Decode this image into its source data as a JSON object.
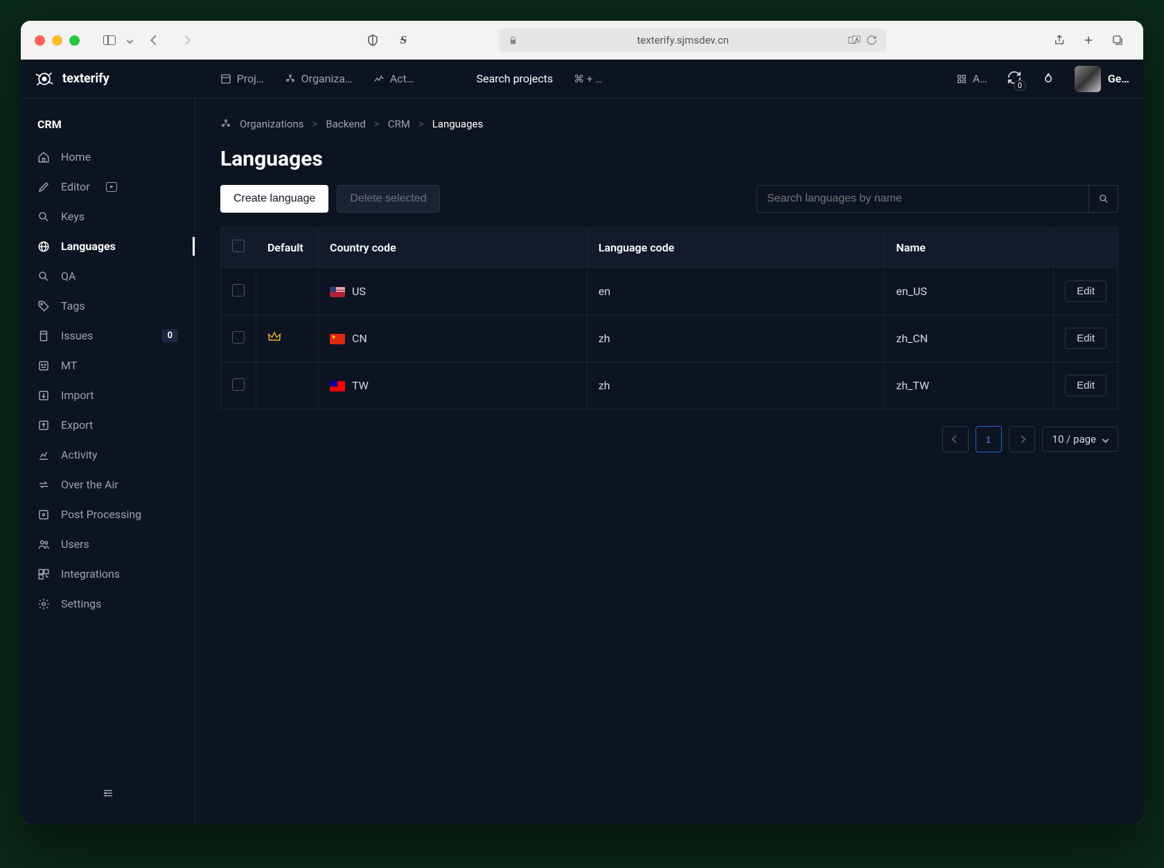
{
  "browser": {
    "url": "texterify.sjmsdev.cn"
  },
  "header": {
    "brand": "texterify",
    "nav": [
      {
        "label": "Proj…",
        "icon": "project"
      },
      {
        "label": "Organiza…",
        "icon": "org"
      },
      {
        "label": "Act…",
        "icon": "activity"
      }
    ],
    "search_label": "Search projects",
    "shortcut": "⌘ + …",
    "tool_label": "A…",
    "sync_count": "0",
    "user_name": "Ge…"
  },
  "sidebar": {
    "title": "CRM",
    "items": [
      {
        "label": "Home",
        "icon": "home"
      },
      {
        "label": "Editor",
        "icon": "edit",
        "ext": true
      },
      {
        "label": "Keys",
        "icon": "search"
      },
      {
        "label": "Languages",
        "icon": "globe",
        "active": true
      },
      {
        "label": "QA",
        "icon": "search"
      },
      {
        "label": "Tags",
        "icon": "tag"
      },
      {
        "label": "Issues",
        "icon": "issue",
        "badge": "0"
      },
      {
        "label": "MT",
        "icon": "mt"
      },
      {
        "label": "Import",
        "icon": "import"
      },
      {
        "label": "Export",
        "icon": "export"
      },
      {
        "label": "Activity",
        "icon": "chart"
      },
      {
        "label": "Over the Air",
        "icon": "swap"
      },
      {
        "label": "Post Processing",
        "icon": "process"
      },
      {
        "label": "Users",
        "icon": "users"
      },
      {
        "label": "Integrations",
        "icon": "integrations"
      },
      {
        "label": "Settings",
        "icon": "settings"
      }
    ]
  },
  "breadcrumb": {
    "items": [
      "Organizations",
      "Backend",
      "CRM"
    ],
    "current": "Languages"
  },
  "page": {
    "title": "Languages",
    "create_btn": "Create language",
    "delete_btn": "Delete selected",
    "search_placeholder": "Search languages by name"
  },
  "table": {
    "headers": {
      "default": "Default",
      "country_code": "Country code",
      "language_code": "Language code",
      "name": "Name"
    },
    "edit_label": "Edit",
    "rows": [
      {
        "default": false,
        "flag": "us",
        "country_code": "US",
        "language_code": "en",
        "name": "en_US"
      },
      {
        "default": true,
        "flag": "cn",
        "country_code": "CN",
        "language_code": "zh",
        "name": "zh_CN"
      },
      {
        "default": false,
        "flag": "tw",
        "country_code": "TW",
        "language_code": "zh",
        "name": "zh_TW"
      }
    ]
  },
  "pagination": {
    "current": "1",
    "per_page": "10 / page"
  }
}
